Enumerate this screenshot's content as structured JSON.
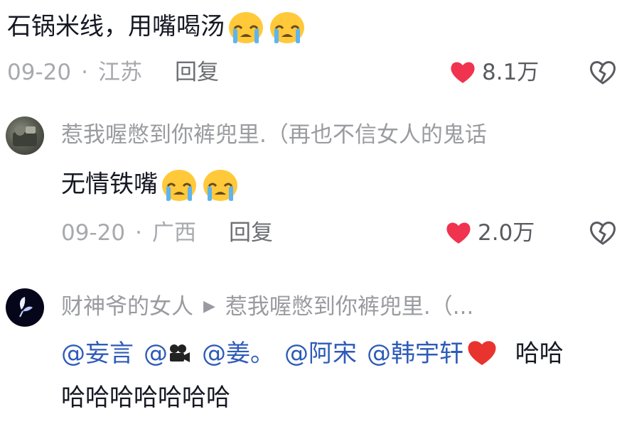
{
  "comments": [
    {
      "text": "石锅米线，用嘴喝汤",
      "date": "09-20",
      "separator": "·",
      "location": "江苏",
      "reply_label": "回复",
      "likes": "8.1万"
    },
    {
      "username": "惹我喔憋到你裤兜里.（再也不信女人的鬼话",
      "text": "无情铁嘴",
      "date": "09-20",
      "separator": "·",
      "location": "广西",
      "reply_label": "回复",
      "likes": "2.0万"
    },
    {
      "username": "财神爷的女人",
      "reply_to": "惹我喔憋到你裤兜里.（...",
      "mentions": [
        "@妄言",
        "@",
        "@姜。",
        "@阿宋",
        "@韩宇轩"
      ],
      "text_tail": " 哈哈",
      "text_line2": "哈哈哈哈哈哈哈"
    }
  ],
  "icons": {
    "emoji": "crying-face-icon",
    "like": "heart-filled-icon",
    "dislike": "broken-heart-icon",
    "camera": "movie-camera-icon",
    "red_heart": "red-heart-icon",
    "reply_arrow": "triangle-right-icon"
  },
  "colors": {
    "like_heart": "#f0334f",
    "mention": "#2e5bb8",
    "meta_gray": "#a8a9ae",
    "text": "#161823"
  }
}
